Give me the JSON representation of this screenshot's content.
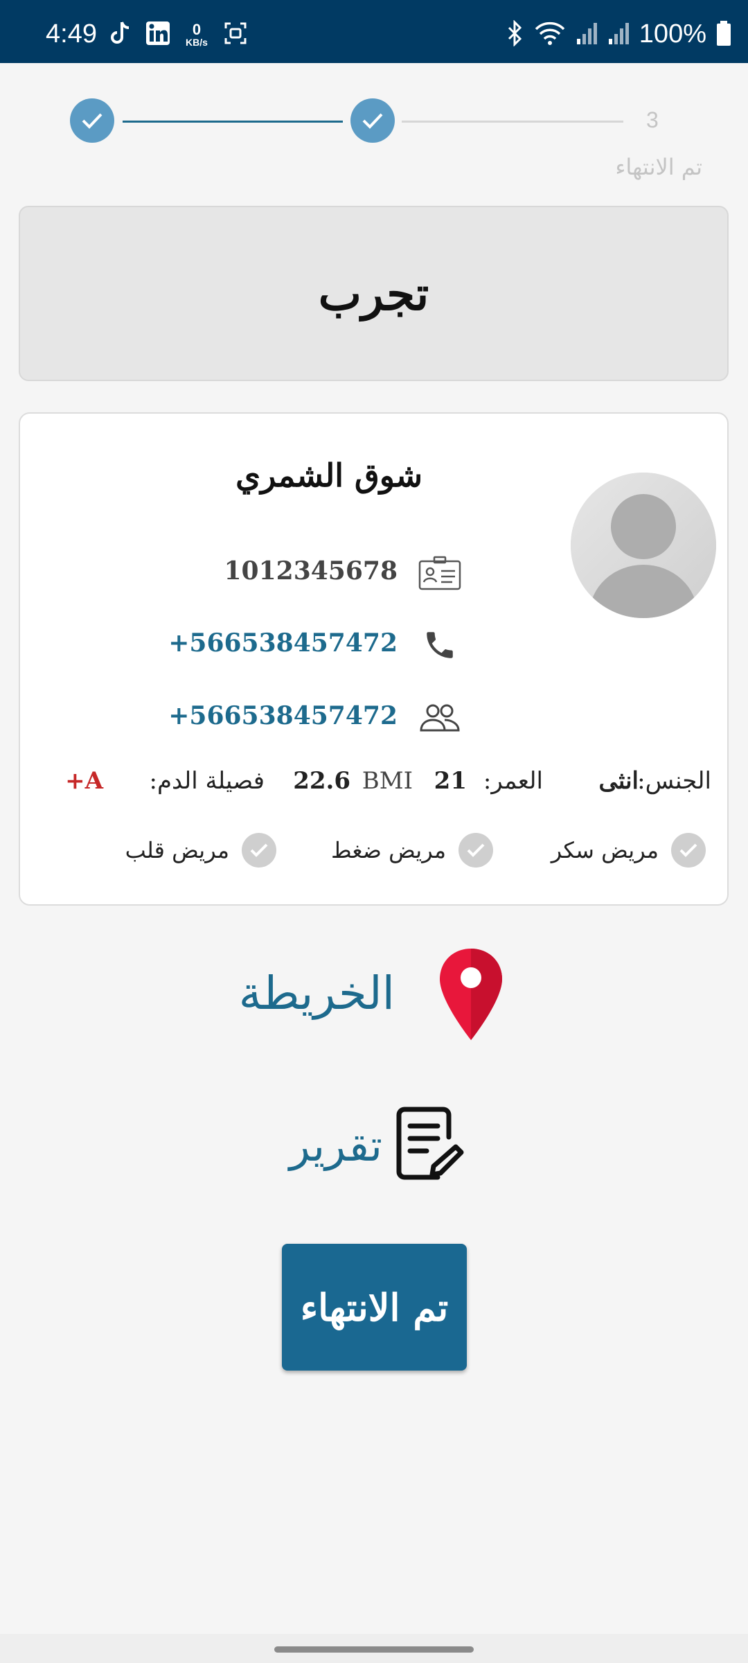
{
  "status_bar": {
    "time": "4:49",
    "kbs_value": "0",
    "kbs_unit": "KB/s",
    "battery": "100%",
    "icons_left": [
      "tiktok-icon",
      "linkedin-icon",
      "data-speed-icon",
      "screenshot-icon"
    ],
    "icons_right": [
      "bluetooth-icon",
      "wifi-icon",
      "signal-icon",
      "signal-icon",
      "battery-icon"
    ]
  },
  "stepper": {
    "steps": [
      {
        "state": "done",
        "label": ""
      },
      {
        "state": "done",
        "label": ""
      },
      {
        "state": "pending",
        "number": "3",
        "label": "تم الانتهاء"
      }
    ],
    "active_color": "#5b9bc4",
    "line_color": "#1d6a8d"
  },
  "title_card": {
    "title": "تجرب"
  },
  "profile": {
    "name": "شوق الشمري",
    "id_number": "1012345678",
    "phone": "+566538457472",
    "family_phone": "+566538457472",
    "gender_label": "الجنس:",
    "gender_value": "انثى",
    "age_label": "العمر:",
    "age_value": "21",
    "bmi_label": "BMI",
    "bmi_value": "22.6",
    "blood_label": "فصيلة الدم:",
    "blood_value": "A+",
    "conditions": [
      {
        "label": "مريض سكر",
        "checked": false
      },
      {
        "label": "مريض ضغط",
        "checked": false
      },
      {
        "label": "مريض قلب",
        "checked": false
      }
    ],
    "link_color": "#1d6a8d",
    "blood_color": "#c62828"
  },
  "actions": {
    "map_label": "الخريطة",
    "report_label": "تقرير",
    "finish_label": "تم الانتهاء",
    "pin_color": "#e8173b"
  }
}
